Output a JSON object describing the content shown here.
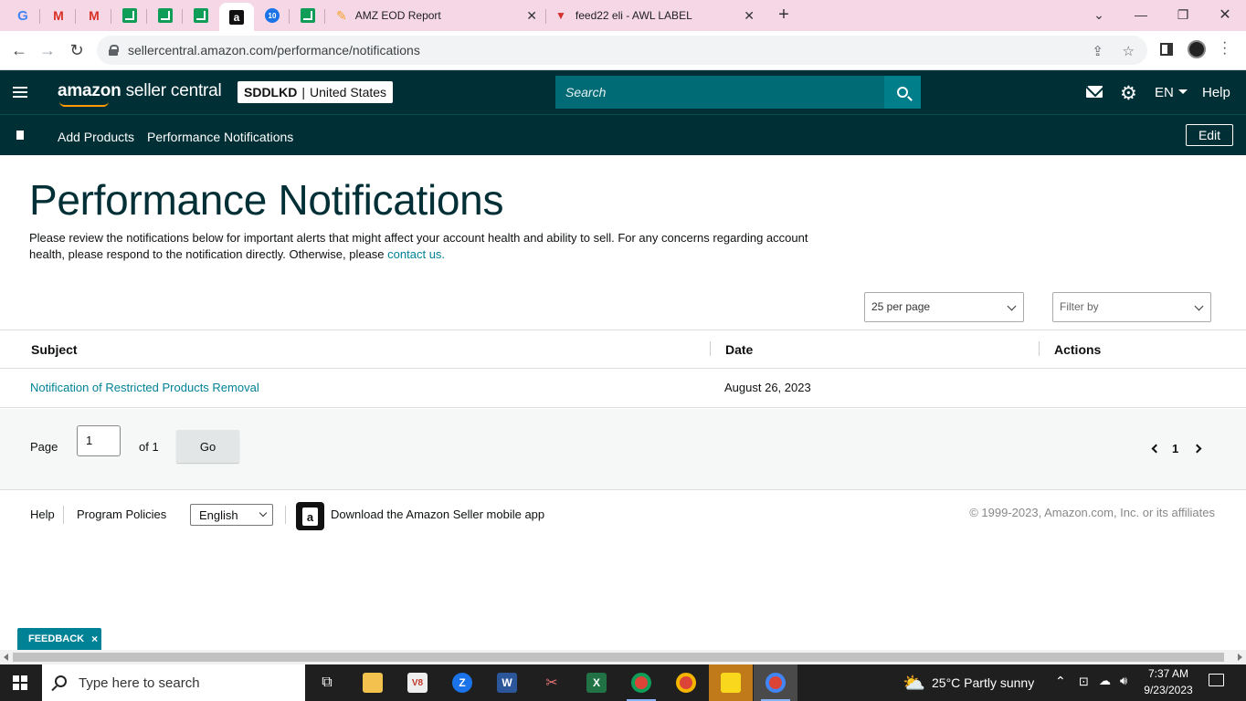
{
  "browser": {
    "tabs": [
      {
        "icon": "google-icon"
      },
      {
        "icon": "gmail-icon"
      },
      {
        "icon": "gmail-icon"
      },
      {
        "icon": "sheets-icon"
      },
      {
        "icon": "sheets-icon"
      },
      {
        "icon": "sheets-icon"
      },
      {
        "icon": "amazon-icon",
        "active": true
      },
      {
        "icon": "ten-badge-icon",
        "badge": "10"
      },
      {
        "icon": "sheets-icon"
      }
    ],
    "wide_tabs": [
      {
        "title": "AMZ EOD Report",
        "icon": "pencil-icon"
      },
      {
        "title": "feed22 eli - AWL LABEL",
        "icon": "triangle-icon"
      }
    ],
    "url": "sellercentral.amazon.com/performance/notifications",
    "accent_color": "#f6d7e6"
  },
  "header": {
    "logo_amazon": "amazon",
    "logo_rest": " seller central",
    "store_id": "SDDLKD",
    "store_separator": "|",
    "store_region": "United States",
    "search_placeholder": "Search",
    "language": "EN",
    "help": "Help",
    "brand_color": "#002f36"
  },
  "bookmarks": {
    "items": [
      "Add Products",
      "Performance Notifications"
    ],
    "edit": "Edit"
  },
  "main": {
    "title": "Performance Notifications",
    "intro_text": "Please review the notifications below for important alerts that might affect your account health and ability to sell. For any concerns regarding account health, please respond to the notification directly. Otherwise, please",
    "intro_link": "contact us.",
    "per_page": "25 per page",
    "filter_placeholder": "Filter by",
    "columns": [
      "Subject",
      "Date",
      "Actions"
    ],
    "rows": [
      {
        "subject": "Notification of Restricted Products Removal",
        "date": "August 26, 2023",
        "actions": ""
      }
    ],
    "pager": {
      "page_label": "Page",
      "page_value": "1",
      "of_label": "of 1",
      "go": "Go",
      "current": "1"
    },
    "link_color": "#008296"
  },
  "footer": {
    "help": "Help",
    "policies": "Program Policies",
    "language": "English",
    "app_text": "Download the Amazon Seller mobile app",
    "copyright": "© 1999-2023, Amazon.com, Inc. or its affiliates",
    "feedback": "FEEDBACK",
    "feedback_close": "×"
  },
  "taskbar": {
    "search_placeholder": "Type here to search",
    "weather": "25°C  Partly sunny",
    "time": "7:37 AM",
    "date": "9/23/2023"
  }
}
